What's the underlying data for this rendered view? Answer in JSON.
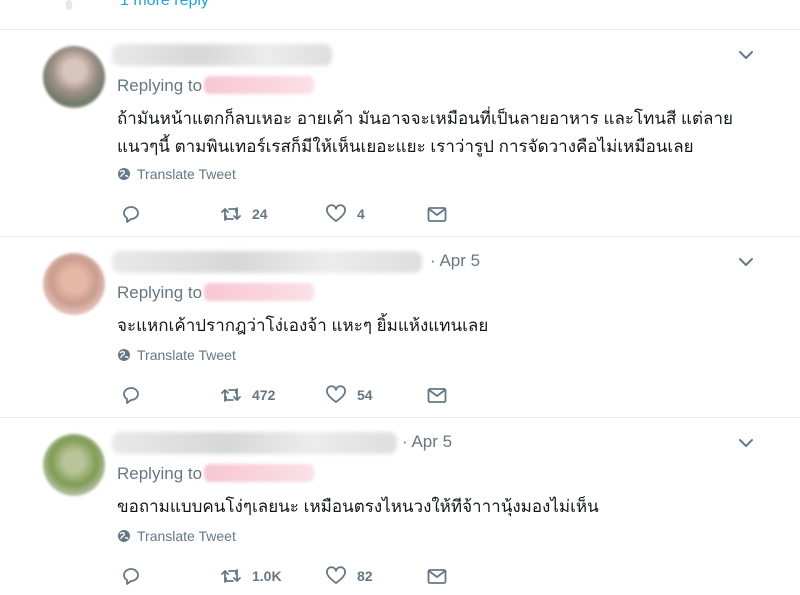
{
  "top": {
    "more_replies": "1 more reply"
  },
  "common": {
    "replying_to": "Replying to",
    "translate": "Translate Tweet"
  },
  "tweets": [
    {
      "date": "",
      "text": "ถ้ามันหน้าแตกก็ลบเหอะ อายเค้า มันอาจจะเหมือนที่เป็นลายอาหาร และโทนสี  แต่ลายแนวๆนี้ ตามพินเทอร์เรสก็มีให้เห็นเยอะแยะ เราว่ารูป การจัดวางคือไม่เหมือนเลย",
      "retweets": "24",
      "likes": "4"
    },
    {
      "date": "· Apr 5",
      "text": "จะแหกเค้าปรากฎว่าโง่เองจ้า แหะๆ ยิ้มแห้งแทนเลย",
      "retweets": "472",
      "likes": "54"
    },
    {
      "date": "· Apr 5",
      "text": "ขอถามแบบคนโง่ๆเลยนะ เหมือนตรงไหนวงให้ทีจ้าาานุ้งมองไม่เห็น",
      "retweets": "1.0K",
      "likes": "82"
    }
  ],
  "icons": {
    "reply": "reply-icon",
    "retweet": "retweet-icon",
    "like": "heart-icon",
    "dm": "envelope-icon",
    "caret": "chevron-down-icon",
    "globe": "globe-icon"
  },
  "colors": {
    "muted": "#657786",
    "link": "#1da1f2",
    "divider": "#e6ecf0"
  }
}
